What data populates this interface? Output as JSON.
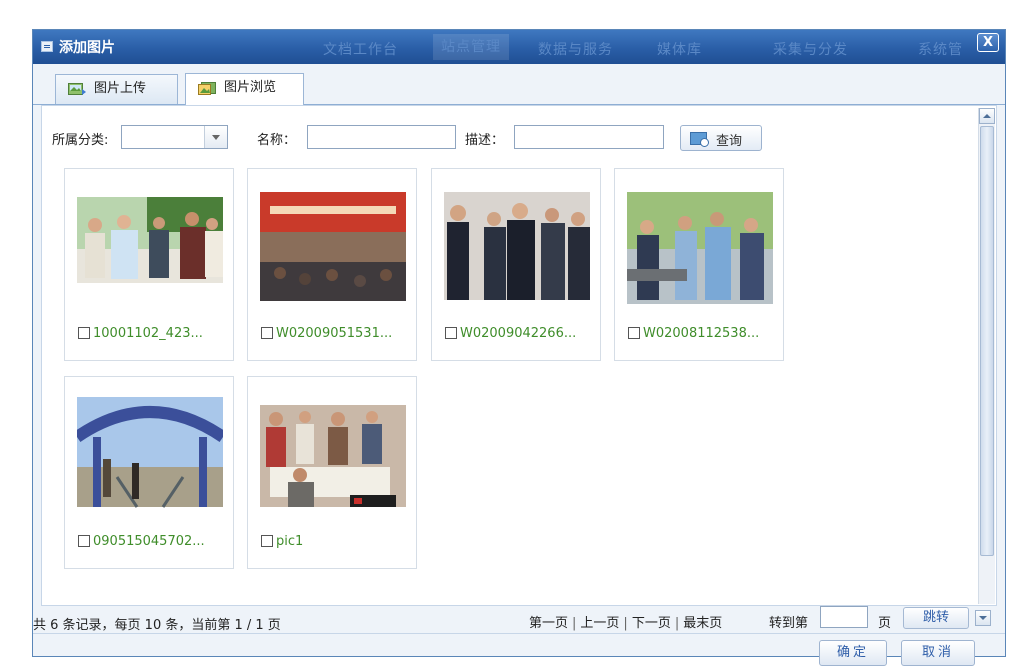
{
  "titlebar": {
    "title": "添加图片",
    "ghost_menu": [
      "文档工作台",
      "站点管理",
      "数据与服务",
      "媒体库",
      "采集与分发",
      "系统管"
    ],
    "close_label": "X"
  },
  "tabs": [
    {
      "label": "图片上传",
      "active": false
    },
    {
      "label": "图片浏览",
      "active": true
    }
  ],
  "filters": {
    "category_label": "所属分类:",
    "category_value": "",
    "name_label": "名称：",
    "name_value": "",
    "desc_label": "描述：",
    "desc_value": "",
    "query_label": "查询"
  },
  "images": [
    {
      "name": "10001102_423...",
      "checked": false
    },
    {
      "name": "W02009051531...",
      "checked": false
    },
    {
      "name": "W02009042266...",
      "checked": false
    },
    {
      "name": "W02008112538...",
      "checked": false
    },
    {
      "name": "090515045702...",
      "checked": false
    },
    {
      "name": "pic1",
      "checked": false
    }
  ],
  "footer": {
    "status": "共 6 条记录，每页 10 条，当前第 1 / 1 页",
    "first": "第一页",
    "prev": "上一页",
    "next": "下一页",
    "last": "最末页",
    "goto_label": "转到第",
    "page_value": "",
    "page_unit": "页",
    "jump_label": "跳转",
    "pager_sep": "|"
  },
  "buttons": {
    "ok": "确定",
    "cancel": "取消"
  },
  "colors": {
    "title_bar": "#2a5ea7",
    "link_green": "#3f8d2a",
    "button_text": "#2f5ea9"
  }
}
